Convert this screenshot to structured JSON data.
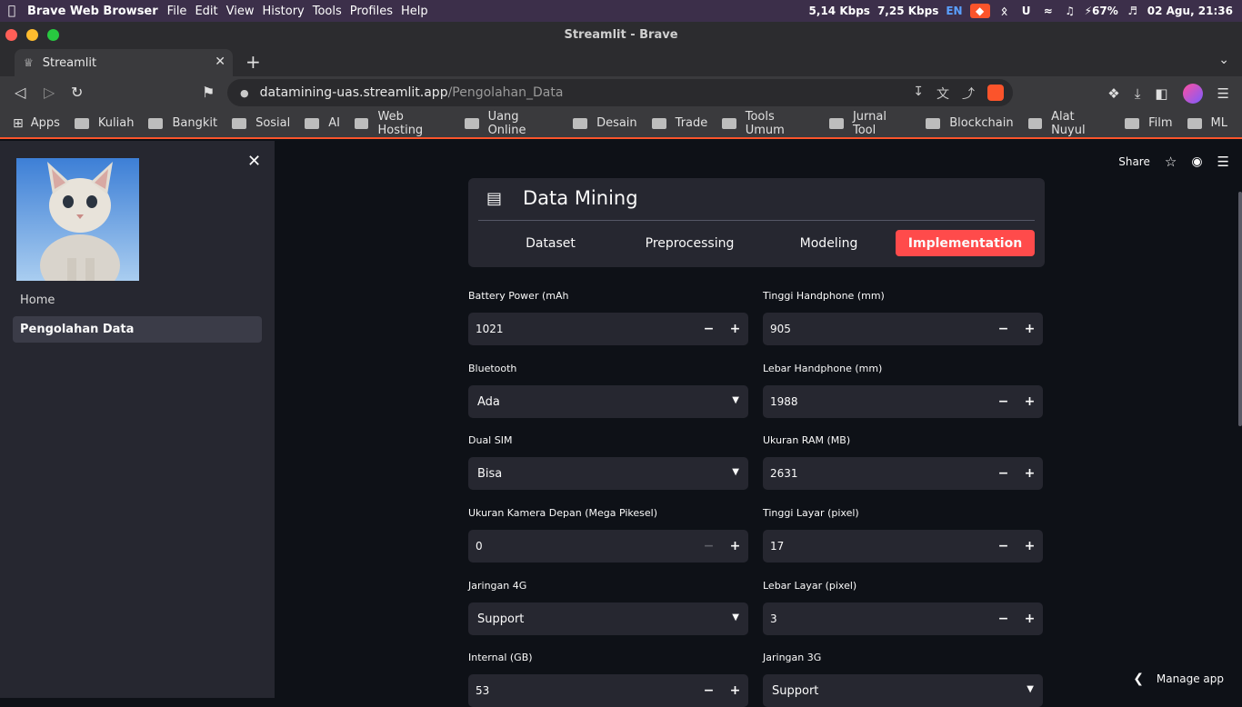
{
  "os_menubar": {
    "app_name": "Brave Web Browser",
    "menus": [
      "File",
      "Edit",
      "View",
      "History",
      "Tools",
      "Profiles",
      "Help"
    ],
    "net_down": "5,14 Kbps",
    "net_up": "7,25 Kbps",
    "lang": "EN",
    "battery": "67%",
    "datetime": "02 Agu, 21:36"
  },
  "window": {
    "title": "Streamlit - Brave"
  },
  "tabs": [
    {
      "label": "Streamlit"
    }
  ],
  "address": {
    "host": "datamining-uas.streamlit.app",
    "path": "/Pengolahan_Data"
  },
  "bookmarks": [
    "Apps",
    "Kuliah",
    "Bangkit",
    "Sosial",
    "AI",
    "Web Hosting",
    "Uang Online",
    "Desain",
    "Trade",
    "Tools Umum",
    "Jurnal Tool",
    "Blockchain",
    "Alat Nuyul",
    "Film",
    "ML"
  ],
  "sidebar": {
    "nav": [
      {
        "label": "Home"
      },
      {
        "label": "Pengolahan Data"
      }
    ]
  },
  "header": {
    "share": "Share"
  },
  "option_menu": {
    "title": "Data Mining",
    "tabs": [
      "Dataset",
      "Preprocessing",
      "Modeling",
      "Implementation"
    ],
    "active": "Implementation"
  },
  "form": {
    "battery_power": {
      "label": "Battery Power (mAh",
      "value": "1021"
    },
    "tinggi_hp": {
      "label": "Tinggi Handphone (mm)",
      "value": "905"
    },
    "bluetooth": {
      "label": "Bluetooth",
      "value": "Ada"
    },
    "lebar_hp": {
      "label": "Lebar Handphone (mm)",
      "value": "1988"
    },
    "dual_sim": {
      "label": "Dual SIM",
      "value": "Bisa"
    },
    "ram": {
      "label": "Ukuran RAM (MB)",
      "value": "2631"
    },
    "kamera_depan": {
      "label": "Ukuran Kamera Depan (Mega Pikesel)",
      "value": "0"
    },
    "tinggi_layar": {
      "label": "Tinggi Layar (pixel)",
      "value": "17"
    },
    "jaringan_4g": {
      "label": "Jaringan 4G",
      "value": "Support"
    },
    "lebar_layar": {
      "label": "Lebar Layar (pixel)",
      "value": "3"
    },
    "internal": {
      "label": "Internal (GB)",
      "value": "53"
    },
    "jaringan_3g": {
      "label": "Jaringan 3G",
      "value": "Support"
    }
  },
  "footer": {
    "manage_app": "Manage app"
  },
  "colors": {
    "accent": "#ff4b4b",
    "sidebar_bg": "#262730",
    "main_bg": "#0e1117",
    "brave_orange": "#fb542b"
  }
}
